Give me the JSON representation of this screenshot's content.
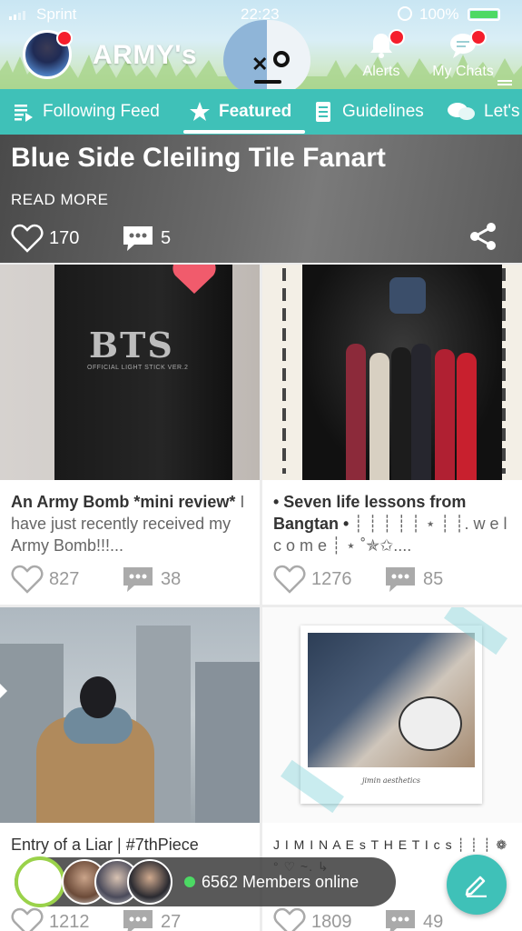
{
  "status_bar": {
    "carrier": "Sprint",
    "time": "22:23",
    "battery": "100%"
  },
  "header": {
    "community_name": "ARMY's",
    "alerts_label": "Alerts",
    "chats_label": "My Chats"
  },
  "tabs": [
    {
      "label": "Following Feed",
      "icon": "feed-icon"
    },
    {
      "label": "Featured",
      "icon": "star-icon",
      "active": true
    },
    {
      "label": "Guidelines",
      "icon": "document-icon"
    },
    {
      "label": "Let's",
      "icon": "chat-bubbles-icon"
    }
  ],
  "hero": {
    "title": "Blue Side Cleiling Tile Fanart",
    "read_more": "READ MORE",
    "likes": "170",
    "comments": "5"
  },
  "cards": [
    {
      "bold": "An Army Bomb *mini review*",
      "rest": " I have just recently received my Army Bomb!!!...",
      "likes": "827",
      "comments": "38",
      "image_brand": "BTS",
      "image_sub": "OFFICIAL LIGHT STICK VER.2"
    },
    {
      "bold": "• Seven life lessons from Bangtan •",
      "rest": " ┊ ┊ ┊ ┊ ┊ ⋆ ┊ ┊. w e l c o m e ┊ ⋆ ˚✯✩....",
      "likes": "1276",
      "comments": "85"
    },
    {
      "bold": "",
      "rest": "Entry of a Liar | #7thPiece",
      "likes": "1212",
      "comments": "27"
    },
    {
      "bold": "",
      "rest": "J I M I N A E s T H E T I c s ┊ ┊ ┊ ❁ ° ♡ ~. ↳",
      "likes": "1809",
      "comments": "49",
      "image_caption": "jimin aesthetics"
    }
  ],
  "online": {
    "text": "6562 Members online"
  },
  "colors": {
    "accent": "#3fc1b8",
    "notification": "#f51e2c",
    "online": "#4cd964"
  }
}
